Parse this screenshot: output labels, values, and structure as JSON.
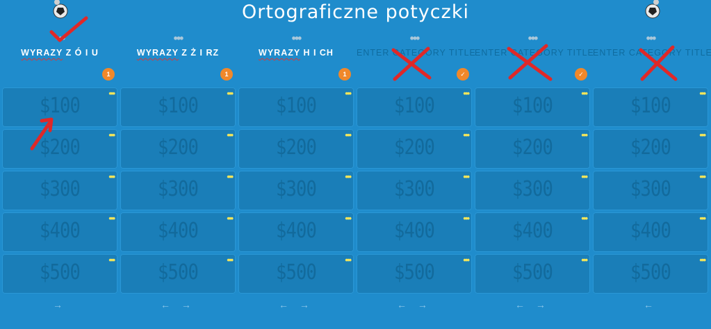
{
  "title": "Ortograficzne potyczki",
  "colors": {
    "background": "#1f8ccc",
    "cell": "#1a7eb8",
    "badge": "#f0882a",
    "annotation": "#e02828",
    "more_dots": "#f2e55b"
  },
  "columns": [
    {
      "category": "WYRAZY Z Ó I U",
      "placeholder": false,
      "badge_type": "count",
      "badge": "1",
      "arrows": "→"
    },
    {
      "category": "WYRAZY Z Ż I RZ",
      "placeholder": false,
      "badge_type": "count",
      "badge": "1",
      "arrows": "← →"
    },
    {
      "category": "WYRAZY H I CH",
      "placeholder": false,
      "badge_type": "count",
      "badge": "1",
      "arrows": "← →"
    },
    {
      "category": "ENTER CATEGORY TITLE",
      "placeholder": true,
      "badge_type": "check",
      "badge": "✓",
      "arrows": "← →"
    },
    {
      "category": "ENTER CATEGORY TITLE",
      "placeholder": true,
      "badge_type": "check",
      "badge": "✓",
      "arrows": "← →"
    },
    {
      "category": "ENTER CATEGORY TITLE",
      "placeholder": true,
      "badge_type": "none",
      "badge": "",
      "arrows": "←"
    }
  ],
  "values": [
    "$100",
    "$200",
    "$300",
    "$400",
    "$500"
  ],
  "more_icon": "•••",
  "top_dots": "•••",
  "icons": {
    "ball": "soccer-ball-icon",
    "more": "more-dots-icon",
    "arrow_left": "arrow-left-icon",
    "arrow_right": "arrow-right-icon"
  }
}
